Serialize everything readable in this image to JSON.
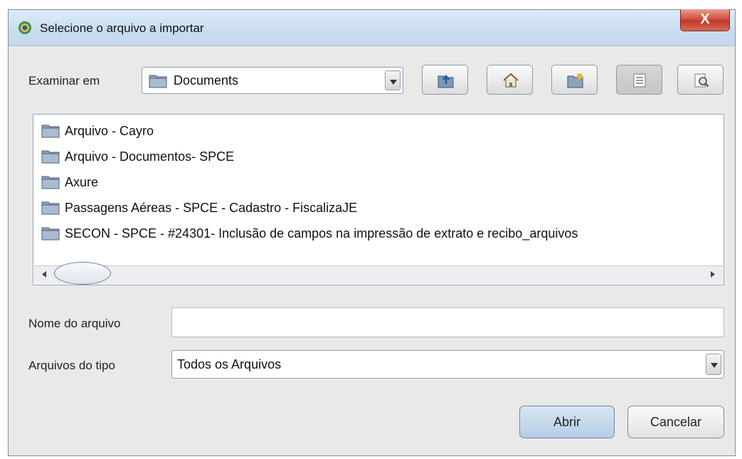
{
  "dialog": {
    "title": "Selecione o arquivo a importar",
    "close_label": "X"
  },
  "look_in": {
    "label": "Examinar em",
    "value": "Documents"
  },
  "toolbar": {
    "buttons": [
      "up-one-level-icon",
      "home-icon",
      "new-folder-icon",
      "list-view-icon",
      "details-view-icon"
    ]
  },
  "files": [
    {
      "name": "Arquivo - Cayro",
      "icon": "folder-icon"
    },
    {
      "name": "Arquivo - Documentos- SPCE",
      "icon": "folder-icon"
    },
    {
      "name": "Axure",
      "icon": "folder-icon"
    },
    {
      "name": "Passagens Aéreas - SPCE - Cadastro - FiscalizaJE",
      "icon": "folder-icon"
    },
    {
      "name": "SECON - SPCE - #24301- Inclusão de campos na impressão de extrato e recibo_arquivos",
      "icon": "folder-icon"
    }
  ],
  "filename": {
    "label": "Nome do arquivo",
    "value": ""
  },
  "filetype": {
    "label": "Arquivos do tipo",
    "value": "Todos os Arquivos"
  },
  "actions": {
    "open_label": "Abrir",
    "cancel_label": "Cancelar"
  },
  "colors": {
    "title_bar": "#c9ddef",
    "close_button": "#c0392b",
    "window_bg": "#e9e9e9",
    "folder": "#7a8fa8"
  }
}
